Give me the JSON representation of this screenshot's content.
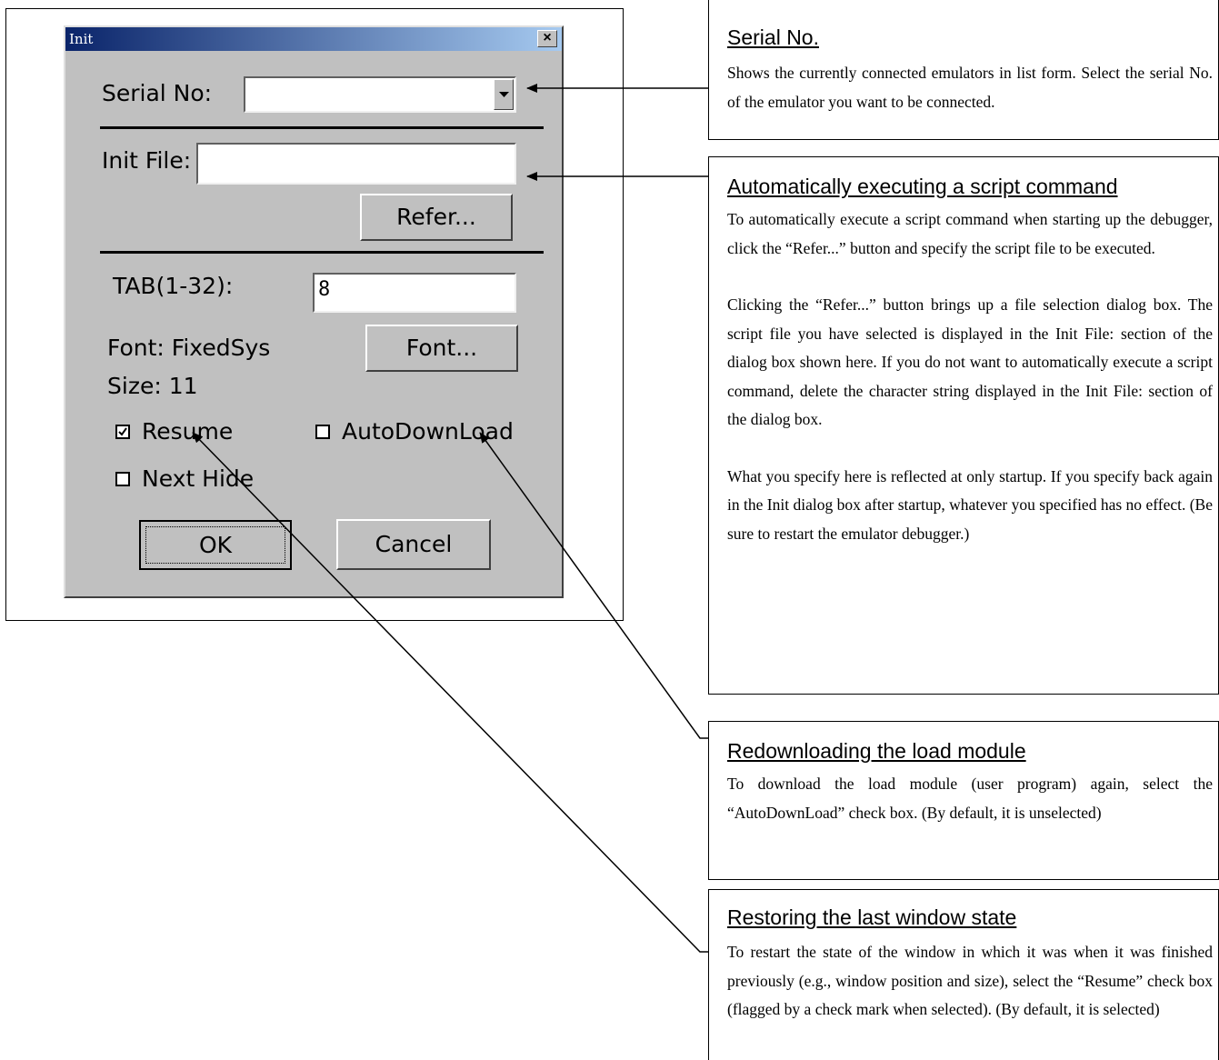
{
  "dialog": {
    "title": "Init",
    "close_symbol": "×",
    "serial_label": "Serial No:",
    "serial_value": "",
    "init_file_label": "Init File:",
    "init_file_value": "",
    "refer_button": "Refer...",
    "tab_label": "TAB(1-32):",
    "tab_value": "8",
    "font_label": "Font: FixedSys",
    "size_label": "Size:  11",
    "font_button": "Font...",
    "resume_label": "Resume",
    "resume_checked": true,
    "autodownload_label": "AutoDownLoad",
    "autodownload_checked": false,
    "next_hide_label": "Next Hide",
    "next_hide_checked": false,
    "ok_button": "OK",
    "cancel_button": "Cancel"
  },
  "notes": {
    "serial": {
      "heading": "Serial No.",
      "body": [
        "Shows the currently connected emulators in list form. Select the serial No. of the emulator you want to be connected."
      ]
    },
    "script": {
      "heading": "Automatically executing a script command",
      "body": [
        "To automatically execute a script command when starting up the debugger, click the “Refer...” button and specify the script file to be executed.",
        "Clicking the “Refer...” button brings up a file selection dialog box. The script file you have selected is displayed in the Init File: section of the dialog box shown here. If you do not want to automatically execute a script command, delete the character string displayed in the Init File: section of the dialog box.",
        "What you specify here is reflected at only startup. If you specify back again in the Init dialog box after startup, whatever you specified has no effect. (Be sure to restart the emulator debugger.)"
      ]
    },
    "redownload": {
      "heading": "Redownloading the load module",
      "body": [
        "To download the load module (user program) again, select the “AutoDownLoad” check box. (By default, it is unselected)"
      ]
    },
    "restore": {
      "heading": "Restoring the last window state",
      "body": [
        "To restart the state of the window in which it was when it was finished previously (e.g., window position and size), select the “Resume” check box (flagged by a check mark when selected). (By default, it is selected)"
      ]
    }
  }
}
